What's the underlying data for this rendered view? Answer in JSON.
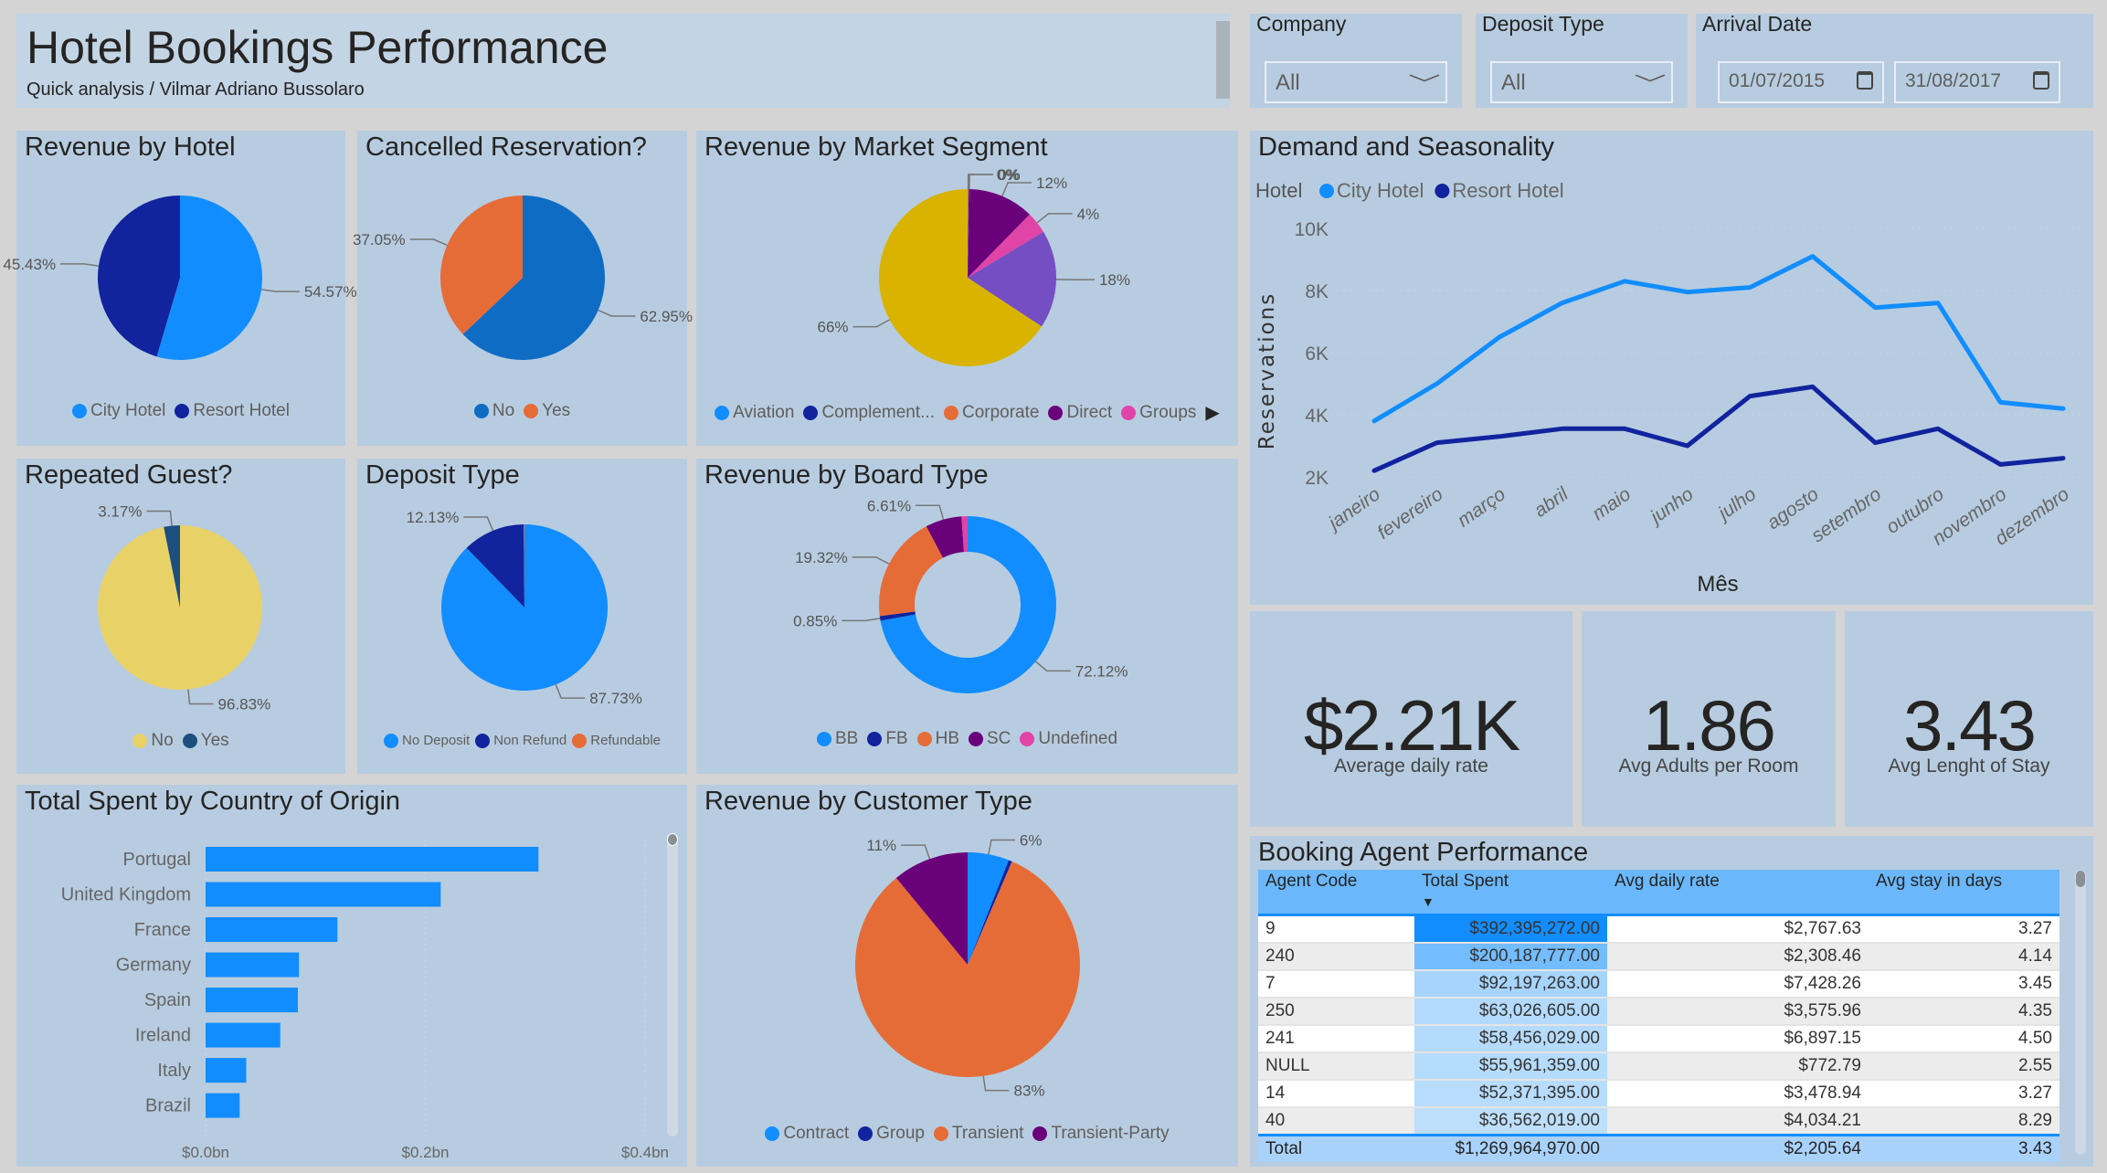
{
  "header": {
    "title": "Hotel Bookings Performance",
    "subtitle": "Quick analysis / Vilmar Adriano Bussolaro"
  },
  "filters": {
    "company": {
      "label": "Company",
      "value": "All"
    },
    "deposit_type": {
      "label": "Deposit Type",
      "value": "All"
    },
    "arrival_date": {
      "label": "Arrival Date",
      "start": "01/07/2015",
      "end": "31/08/2017"
    }
  },
  "chart_data": [
    {
      "type": "pie",
      "title": "Revenue by Hotel",
      "slices": [
        {
          "name": "City Hotel",
          "value": 54.57,
          "label": "54.57%",
          "color": "#118dff"
        },
        {
          "name": "Resort Hotel",
          "value": 45.43,
          "label": "45.43%",
          "color": "#12239e"
        }
      ],
      "legend": [
        {
          "name": "City Hotel",
          "color": "#118dff"
        },
        {
          "name": "Resort Hotel",
          "color": "#12239e"
        }
      ]
    },
    {
      "type": "pie",
      "title": "Cancelled Reservation?",
      "slices": [
        {
          "name": "No",
          "value": 62.95,
          "label": "62.95%",
          "color": "#0f6cc5"
        },
        {
          "name": "Yes",
          "value": 37.05,
          "label": "37.05%",
          "color": "#e66c37"
        }
      ],
      "legend": [
        {
          "name": "No",
          "color": "#0f6cc5"
        },
        {
          "name": "Yes",
          "color": "#e66c37"
        }
      ]
    },
    {
      "type": "pie",
      "title": "Revenue by Market Segment",
      "slices": [
        {
          "value": 0.2,
          "label": "0%",
          "color": "#e66c37"
        },
        {
          "value": 0.2,
          "label": "0%",
          "color": "#12239e"
        },
        {
          "name": "Direct",
          "value": 12,
          "label": "12%",
          "color": "#6b007b"
        },
        {
          "name": "Groups",
          "value": 4,
          "label": "4%",
          "color": "#e044a7"
        },
        {
          "value": 18,
          "label": "18%",
          "color": "#744ec2"
        },
        {
          "value": 66,
          "label": "66%",
          "color": "#d9b300"
        }
      ],
      "legend": [
        {
          "name": "Aviation",
          "color": "#118dff"
        },
        {
          "name": "Complement...",
          "color": "#12239e"
        },
        {
          "name": "Corporate",
          "color": "#e66c37"
        },
        {
          "name": "Direct",
          "color": "#6b007b"
        },
        {
          "name": "Groups",
          "color": "#e044a7"
        }
      ]
    },
    {
      "type": "pie",
      "title": "Repeated Guest?",
      "slices": [
        {
          "name": "No",
          "value": 96.83,
          "label": "96.83%",
          "color": "#e8d166"
        },
        {
          "name": "Yes",
          "value": 3.17,
          "label": "3.17%",
          "color": "#1c4f7e"
        }
      ],
      "legend": [
        {
          "name": "No",
          "color": "#e8d166"
        },
        {
          "name": "Yes",
          "color": "#1c4f7e"
        }
      ]
    },
    {
      "type": "pie",
      "title": "Deposit Type",
      "slices": [
        {
          "name": "No Deposit",
          "value": 87.73,
          "label": "87.73%",
          "color": "#118dff"
        },
        {
          "name": "Non Refund",
          "value": 12.13,
          "label": "12.13%",
          "color": "#12239e"
        },
        {
          "name": "Refundable",
          "value": 0.14,
          "color": "#e66c37"
        }
      ],
      "legend": [
        {
          "name": "No Deposit",
          "color": "#118dff"
        },
        {
          "name": "Non Refund",
          "color": "#12239e"
        },
        {
          "name": "Refundable",
          "color": "#e66c37"
        }
      ]
    },
    {
      "type": "pie",
      "title": "Revenue by Board Type",
      "donut": true,
      "slices": [
        {
          "name": "BB",
          "value": 72.12,
          "label": "72.12%",
          "color": "#118dff"
        },
        {
          "name": "FB",
          "value": 0.85,
          "label": "0.85%",
          "color": "#12239e"
        },
        {
          "name": "HB",
          "value": 19.32,
          "label": "19.32%",
          "color": "#e66c37"
        },
        {
          "name": "SC",
          "value": 6.61,
          "label": "6.61%",
          "color": "#6b007b"
        },
        {
          "name": "Undefined",
          "value": 1.1,
          "color": "#e044a7"
        }
      ],
      "legend": [
        {
          "name": "BB",
          "color": "#118dff"
        },
        {
          "name": "FB",
          "color": "#12239e"
        },
        {
          "name": "HB",
          "color": "#e66c37"
        },
        {
          "name": "SC",
          "color": "#6b007b"
        },
        {
          "name": "Undefined",
          "color": "#e044a7"
        }
      ]
    },
    {
      "type": "pie",
      "title": "Revenue by Customer Type",
      "slices": [
        {
          "name": "Contract",
          "value": 6,
          "label": "6%",
          "color": "#118dff"
        },
        {
          "name": "Group",
          "value": 0.5,
          "color": "#12239e"
        },
        {
          "name": "Transient",
          "value": 83,
          "label": "83%",
          "color": "#e66c37"
        },
        {
          "name": "Transient-Party",
          "value": 11,
          "label": "11%",
          "color": "#6b007b"
        }
      ],
      "legend": [
        {
          "name": "Contract",
          "color": "#118dff"
        },
        {
          "name": "Group",
          "color": "#12239e"
        },
        {
          "name": "Transient",
          "color": "#e66c37"
        },
        {
          "name": "Transient-Party",
          "color": "#6b007b"
        }
      ]
    },
    {
      "type": "bar",
      "orientation": "horizontal",
      "title": "Total Spent by Country of Origin",
      "categories": [
        "Portugal",
        "United Kingdom",
        "France",
        "Germany",
        "Spain",
        "Ireland",
        "Italy",
        "Brazil"
      ],
      "values": [
        0.303,
        0.214,
        0.12,
        0.085,
        0.084,
        0.068,
        0.037,
        0.031
      ],
      "unit": "bn USD",
      "xlim": [
        0,
        0.4
      ],
      "xticks": [
        "$0.0bn",
        "$0.2bn",
        "$0.4bn"
      ],
      "xtick_values": [
        0,
        0.2,
        0.4
      ],
      "color": "#118dff",
      "grid": true
    },
    {
      "type": "line",
      "title": "Demand and Seasonality",
      "legend_title": "Hotel",
      "xlabel": "Mês",
      "ylabel": "Reservations",
      "categories": [
        "janeiro",
        "fevereiro",
        "março",
        "abril",
        "maio",
        "junho",
        "julho",
        "agosto",
        "setembro",
        "outubro",
        "novembro",
        "dezembro"
      ],
      "series": [
        {
          "name": "City Hotel",
          "color": "#118dff",
          "values": [
            3800,
            5000,
            6500,
            7600,
            8300,
            7950,
            8100,
            9100,
            7450,
            7600,
            4400,
            4200
          ]
        },
        {
          "name": "Resort Hotel",
          "color": "#12239e",
          "values": [
            2200,
            3100,
            3300,
            3550,
            3550,
            3000,
            4600,
            4900,
            3100,
            3550,
            2400,
            2600
          ]
        }
      ],
      "ylim": [
        2000,
        10000
      ],
      "yticks": [
        "2K",
        "4K",
        "6K",
        "8K",
        "10K"
      ],
      "ytick_values": [
        2000,
        4000,
        6000,
        8000,
        10000
      ],
      "legend_position": "top-left",
      "grid": true
    }
  ],
  "kpis": [
    {
      "value": "$2.21K",
      "label": "Average daily rate"
    },
    {
      "value": "1.86",
      "label": "Avg Adults per Room"
    },
    {
      "value": "3.43",
      "label": "Avg Lenght of Stay"
    }
  ],
  "agent_table": {
    "title": "Booking Agent Performance",
    "columns": [
      "Agent Code",
      "Total Spent",
      "Avg daily rate",
      "Avg stay in days"
    ],
    "sort_indicator": "▼",
    "rows": [
      {
        "agent": "9",
        "spent": "$392,395,272.00",
        "spent_value": 392395272,
        "adr": "$2,767.63",
        "stay": "3.27"
      },
      {
        "agent": "240",
        "spent": "$200,187,777.00",
        "spent_value": 200187777,
        "adr": "$2,308.46",
        "stay": "4.14"
      },
      {
        "agent": "7",
        "spent": "$92,197,263.00",
        "spent_value": 92197263,
        "adr": "$7,428.26",
        "stay": "3.45"
      },
      {
        "agent": "250",
        "spent": "$63,026,605.00",
        "spent_value": 63026605,
        "adr": "$3,575.96",
        "stay": "4.35"
      },
      {
        "agent": "241",
        "spent": "$58,456,029.00",
        "spent_value": 58456029,
        "adr": "$6,897.15",
        "stay": "4.50"
      },
      {
        "agent": "NULL",
        "spent": "$55,961,359.00",
        "spent_value": 55961359,
        "adr": "$772.79",
        "stay": "2.55"
      },
      {
        "agent": "14",
        "spent": "$52,371,395.00",
        "spent_value": 52371395,
        "adr": "$3,478.94",
        "stay": "3.27"
      },
      {
        "agent": "40",
        "spent": "$36,562,019.00",
        "spent_value": 36562019,
        "adr": "$4,034.21",
        "stay": "8.29"
      }
    ],
    "total": {
      "label": "Total",
      "spent": "$1,269,964,970.00",
      "adr": "$2,205.64",
      "stay": "3.43"
    }
  }
}
